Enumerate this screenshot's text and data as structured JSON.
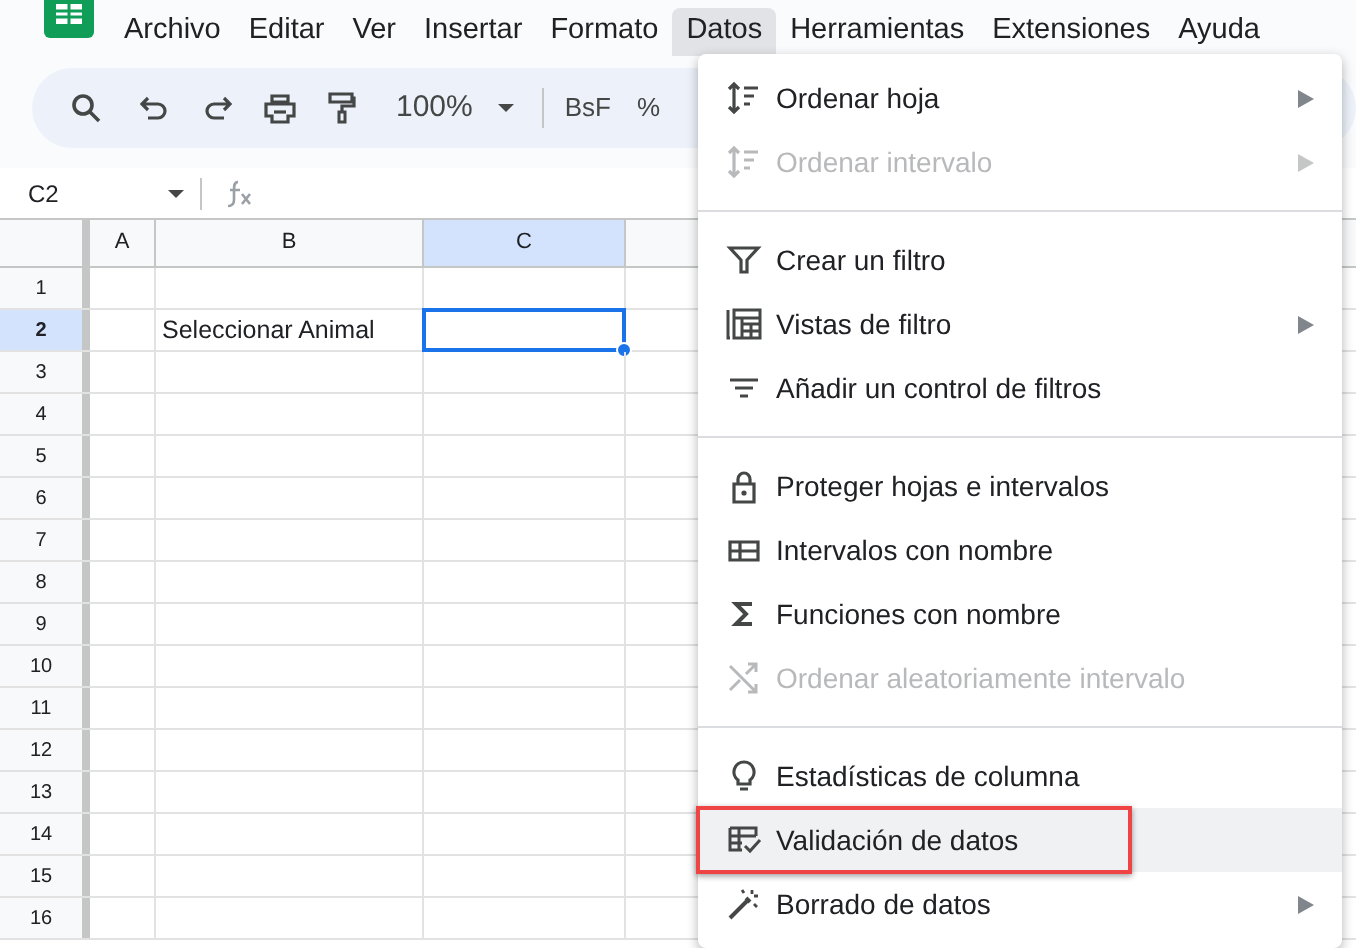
{
  "menu_bar": [
    {
      "label": "Archivo",
      "selected": false
    },
    {
      "label": "Editar",
      "selected": false
    },
    {
      "label": "Ver",
      "selected": false
    },
    {
      "label": "Insertar",
      "selected": false
    },
    {
      "label": "Formato",
      "selected": false
    },
    {
      "label": "Datos",
      "selected": true
    },
    {
      "label": "Herramientas",
      "selected": false
    },
    {
      "label": "Extensiones",
      "selected": false
    },
    {
      "label": "Ayuda",
      "selected": false
    }
  ],
  "toolbar": {
    "zoom": "100%",
    "format_text": "BsF",
    "percent": "%"
  },
  "name_box": "C2",
  "columns": [
    {
      "label": "A",
      "selected": false
    },
    {
      "label": "B",
      "selected": false
    },
    {
      "label": "C",
      "selected": true
    }
  ],
  "rows": [
    {
      "label": "1",
      "selected": false
    },
    {
      "label": "2",
      "selected": true,
      "column_b": "Seleccionar Animal"
    },
    {
      "label": "3",
      "selected": false
    },
    {
      "label": "4",
      "selected": false
    },
    {
      "label": "5",
      "selected": false
    },
    {
      "label": "6",
      "selected": false
    },
    {
      "label": "7",
      "selected": false
    },
    {
      "label": "8",
      "selected": false
    },
    {
      "label": "9",
      "selected": false
    },
    {
      "label": "10",
      "selected": false
    },
    {
      "label": "11",
      "selected": false
    },
    {
      "label": "12",
      "selected": false
    },
    {
      "label": "13",
      "selected": false
    },
    {
      "label": "14",
      "selected": false
    },
    {
      "label": "15",
      "selected": false
    },
    {
      "label": "16",
      "selected": false
    }
  ],
  "data_menu": {
    "sections": [
      {
        "items": [
          {
            "label": "Ordenar hoja",
            "disabled": false,
            "submenu": true,
            "selected": false,
            "callout": false
          },
          {
            "label": "Ordenar intervalo",
            "disabled": true,
            "submenu": true,
            "selected": false,
            "callout": false
          }
        ]
      },
      {
        "items": [
          {
            "label": "Crear un filtro",
            "disabled": false,
            "submenu": false,
            "selected": false,
            "callout": false
          },
          {
            "label": "Vistas de filtro",
            "disabled": false,
            "submenu": true,
            "selected": false,
            "callout": false
          },
          {
            "label": "Añadir un control de filtros",
            "disabled": false,
            "submenu": false,
            "selected": false,
            "callout": false
          }
        ]
      },
      {
        "items": [
          {
            "label": "Proteger hojas e intervalos",
            "disabled": false,
            "submenu": false,
            "selected": false,
            "callout": false
          },
          {
            "label": "Intervalos con nombre",
            "disabled": false,
            "submenu": false,
            "selected": false,
            "callout": false
          },
          {
            "label": "Funciones con nombre",
            "disabled": false,
            "submenu": false,
            "selected": false,
            "callout": false
          },
          {
            "label": "Ordenar aleatoriamente intervalo",
            "disabled": true,
            "submenu": false,
            "selected": false,
            "callout": false
          }
        ]
      },
      {
        "items": [
          {
            "label": "Estadísticas de columna",
            "disabled": false,
            "submenu": false,
            "selected": false,
            "callout": false
          },
          {
            "label": "Validación de datos",
            "disabled": false,
            "submenu": false,
            "selected": true,
            "callout": true
          },
          {
            "label": "Borrado de datos",
            "disabled": false,
            "submenu": true,
            "selected": false,
            "callout": false
          }
        ]
      }
    ]
  }
}
